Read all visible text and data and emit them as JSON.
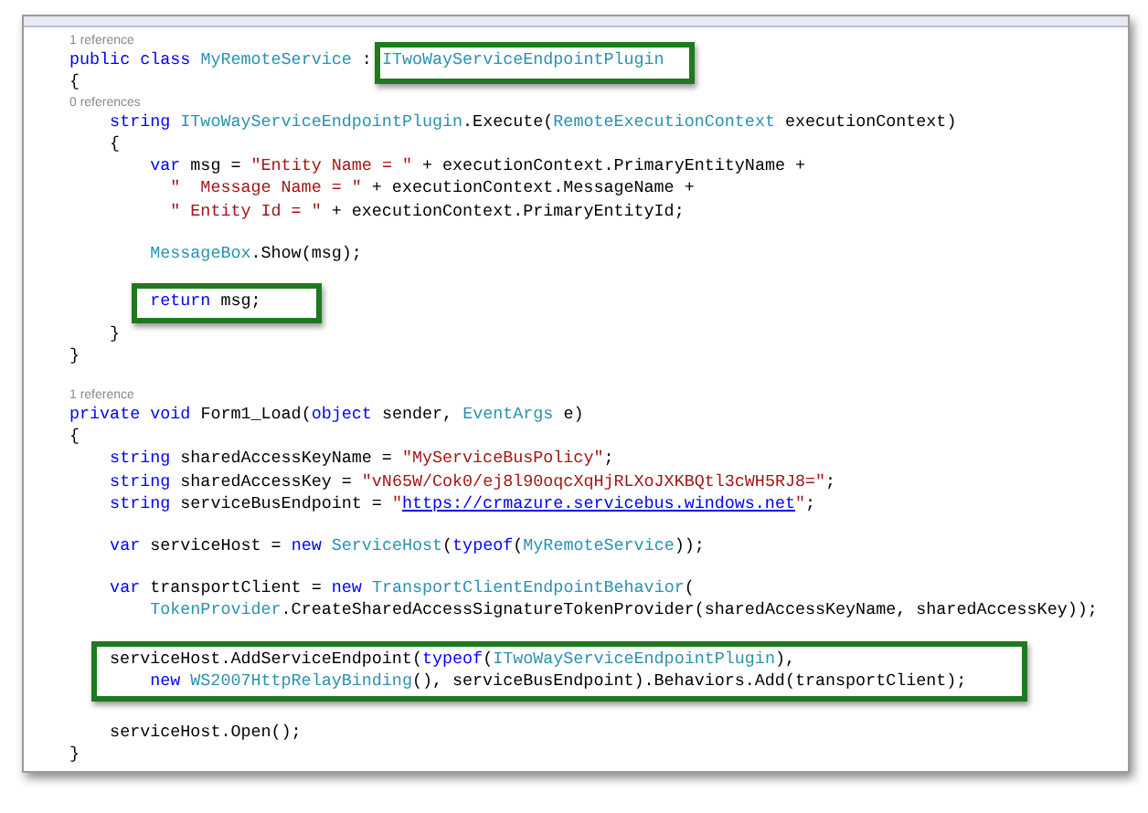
{
  "code": [
    {
      "kind": "reference",
      "text": "1 reference"
    },
    {
      "kind": "line",
      "tokens": [
        {
          "kind": "keyword",
          "text": "public class "
        },
        {
          "kind": "type",
          "text": "MyRemoteService"
        },
        {
          "kind": "plain",
          "text": " : "
        },
        {
          "kind": "type",
          "text": "ITwoWayServiceEndpointPlugin",
          "boxed": true
        }
      ]
    },
    {
      "kind": "line",
      "tokens": [
        {
          "kind": "plain",
          "text": "{"
        }
      ]
    },
    {
      "kind": "reference",
      "text": "0 references"
    },
    {
      "kind": "line",
      "tokens": [
        {
          "kind": "keyword",
          "text": "    string "
        },
        {
          "kind": "type",
          "text": "ITwoWayServiceEndpointPlugin"
        },
        {
          "kind": "plain",
          "text": ".Execute("
        },
        {
          "kind": "type",
          "text": "RemoteExecutionContext"
        },
        {
          "kind": "plain",
          "text": " executionContext)"
        }
      ]
    },
    {
      "kind": "line",
      "tokens": [
        {
          "kind": "plain",
          "text": "    {"
        }
      ]
    },
    {
      "kind": "line",
      "tokens": [
        {
          "kind": "keyword",
          "text": "        var"
        },
        {
          "kind": "plain",
          "text": " msg = "
        },
        {
          "kind": "string",
          "text": "\"Entity Name = \""
        },
        {
          "kind": "plain",
          "text": " + executionContext.PrimaryEntityName +"
        }
      ]
    },
    {
      "kind": "line",
      "tokens": [
        {
          "kind": "string",
          "text": "          \"  Message Name = \""
        },
        {
          "kind": "plain",
          "text": " + executionContext.MessageName +"
        }
      ]
    },
    {
      "kind": "line",
      "tokens": [
        {
          "kind": "string",
          "text": "          \" Entity Id = \""
        },
        {
          "kind": "plain",
          "text": " + executionContext.PrimaryEntityId;"
        }
      ]
    },
    {
      "kind": "blank"
    },
    {
      "kind": "line",
      "tokens": [
        {
          "kind": "type",
          "text": "        MessageBox"
        },
        {
          "kind": "plain",
          "text": ".Show(msg);"
        }
      ]
    },
    {
      "kind": "blank"
    },
    {
      "kind": "box",
      "lines": [
        {
          "tokens": [
            {
              "kind": "keyword",
              "text": "        return"
            },
            {
              "kind": "plain",
              "text": " msg;"
            }
          ]
        }
      ]
    },
    {
      "kind": "line",
      "tokens": [
        {
          "kind": "plain",
          "text": "    }"
        }
      ]
    },
    {
      "kind": "line",
      "tokens": [
        {
          "kind": "plain",
          "text": "}"
        }
      ]
    },
    {
      "kind": "blank"
    },
    {
      "kind": "reference",
      "text": "1 reference"
    },
    {
      "kind": "line",
      "tokens": [
        {
          "kind": "keyword",
          "text": "private void "
        },
        {
          "kind": "plain",
          "text": "Form1_Load("
        },
        {
          "kind": "keyword",
          "text": "object"
        },
        {
          "kind": "plain",
          "text": " sender, "
        },
        {
          "kind": "type",
          "text": "EventArgs"
        },
        {
          "kind": "plain",
          "text": " e)"
        }
      ]
    },
    {
      "kind": "line",
      "tokens": [
        {
          "kind": "plain",
          "text": "{"
        }
      ]
    },
    {
      "kind": "line",
      "tokens": [
        {
          "kind": "keyword",
          "text": "    string"
        },
        {
          "kind": "plain",
          "text": " sharedAccessKeyName = "
        },
        {
          "kind": "string",
          "text": "\"MyServiceBusPolicy\""
        },
        {
          "kind": "plain",
          "text": ";"
        }
      ]
    },
    {
      "kind": "line",
      "tokens": [
        {
          "kind": "keyword",
          "text": "    string"
        },
        {
          "kind": "plain",
          "text": " sharedAccessKey = "
        },
        {
          "kind": "string",
          "text": "\"vN65W/Cok0/ej8l90oqcXqHjRLXoJXKBQtl3cWH5RJ8=\""
        },
        {
          "kind": "plain",
          "text": ";"
        }
      ]
    },
    {
      "kind": "line",
      "tokens": [
        {
          "kind": "keyword",
          "text": "    string"
        },
        {
          "kind": "plain",
          "text": " serviceBusEndpoint = "
        },
        {
          "kind": "string",
          "text": "\""
        },
        {
          "kind": "link",
          "text": "https://crmazure.servicebus.windows.net"
        },
        {
          "kind": "string",
          "text": "\""
        },
        {
          "kind": "plain",
          "text": ";"
        }
      ]
    },
    {
      "kind": "blank"
    },
    {
      "kind": "line",
      "tokens": [
        {
          "kind": "keyword",
          "text": "    var"
        },
        {
          "kind": "plain",
          "text": " serviceHost = "
        },
        {
          "kind": "keyword",
          "text": "new "
        },
        {
          "kind": "type",
          "text": "ServiceHost"
        },
        {
          "kind": "plain",
          "text": "("
        },
        {
          "kind": "keyword",
          "text": "typeof"
        },
        {
          "kind": "plain",
          "text": "("
        },
        {
          "kind": "type",
          "text": "MyRemoteService"
        },
        {
          "kind": "plain",
          "text": "));"
        }
      ]
    },
    {
      "kind": "blank"
    },
    {
      "kind": "line",
      "tokens": [
        {
          "kind": "keyword",
          "text": "    var"
        },
        {
          "kind": "plain",
          "text": " transportClient = "
        },
        {
          "kind": "keyword",
          "text": "new "
        },
        {
          "kind": "type",
          "text": "TransportClientEndpointBehavior"
        },
        {
          "kind": "plain",
          "text": "("
        }
      ]
    },
    {
      "kind": "line",
      "tokens": [
        {
          "kind": "type",
          "text": "        TokenProvider"
        },
        {
          "kind": "plain",
          "text": ".CreateSharedAccessSignatureTokenProvider(sharedAccessKeyName, sharedAccessKey));"
        }
      ]
    },
    {
      "kind": "blank"
    },
    {
      "kind": "box",
      "lines": [
        {
          "tokens": [
            {
              "kind": "plain",
              "text": "    serviceHost.AddServiceEndpoint("
            },
            {
              "kind": "keyword",
              "text": "typeof"
            },
            {
              "kind": "plain",
              "text": "("
            },
            {
              "kind": "type",
              "text": "ITwoWayServiceEndpointPlugin"
            },
            {
              "kind": "plain",
              "text": "),"
            }
          ]
        },
        {
          "tokens": [
            {
              "kind": "keyword",
              "text": "        new "
            },
            {
              "kind": "type",
              "text": "WS2007HttpRelayBinding"
            },
            {
              "kind": "plain",
              "text": "(), serviceBusEndpoint).Behaviors.Add(transportClient);"
            }
          ]
        }
      ]
    },
    {
      "kind": "blank"
    },
    {
      "kind": "line",
      "tokens": [
        {
          "kind": "plain",
          "text": "    serviceHost.Open();"
        }
      ]
    },
    {
      "kind": "line",
      "tokens": [
        {
          "kind": "plain",
          "text": "}"
        }
      ]
    }
  ]
}
